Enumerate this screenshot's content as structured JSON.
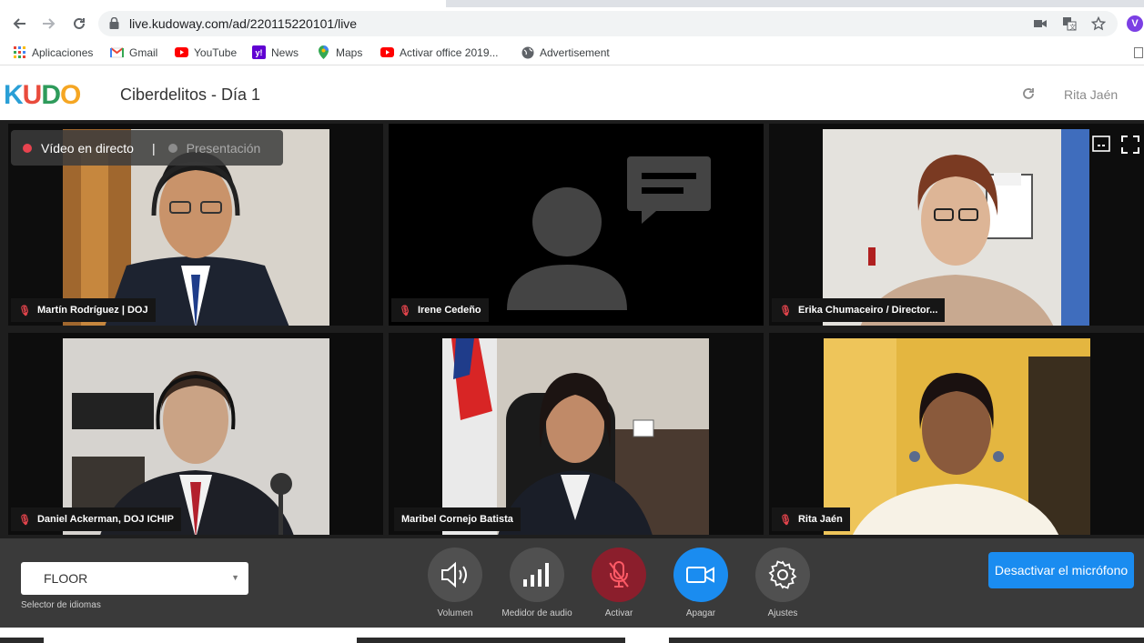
{
  "browser": {
    "url": "live.kudoway.com/ad/220115220101/live",
    "bookmarks": [
      {
        "label": "Aplicaciones",
        "icon": "apps-grid-icon"
      },
      {
        "label": "Gmail",
        "icon": "gmail-icon"
      },
      {
        "label": "YouTube",
        "icon": "youtube-icon"
      },
      {
        "label": "News",
        "icon": "yahoo-icon"
      },
      {
        "label": "Maps",
        "icon": "maps-pin-icon"
      },
      {
        "label": "Activar office 2019...",
        "icon": "youtube-icon"
      },
      {
        "label": "Advertisement",
        "icon": "globe-icon"
      }
    ]
  },
  "app": {
    "logo_letters": [
      "K",
      "U",
      "D",
      "O"
    ],
    "title": "Ciberdelitos - Día 1",
    "user": "Rita Jaén"
  },
  "stream": {
    "live_label": "Vídeo en directo",
    "separator": "|",
    "presentation_label": "Presentación"
  },
  "participants": [
    {
      "name": "Martín Rodríguez | DOJ",
      "muted": true,
      "video": true
    },
    {
      "name": "Irene Cedeño",
      "muted": true,
      "video": false
    },
    {
      "name": "Erika Chumaceiro / Director...",
      "muted": true,
      "video": true
    },
    {
      "name": "Daniel Ackerman, DOJ ICHIP",
      "muted": true,
      "video": true
    },
    {
      "name": "Maribel Cornejo Batista",
      "muted": false,
      "video": true
    },
    {
      "name": "Rita Jaén",
      "muted": true,
      "video": true
    }
  ],
  "controls": {
    "language_value": "FLOOR",
    "language_caption": "Selector de idiomas",
    "volume_label": "Volumen",
    "audio_meter_label": "Medidor de audio",
    "activate_label": "Activar",
    "camera_label": "Apagar",
    "settings_label": "Ajustes",
    "mute_button_label": "Desactivar el micrófono"
  },
  "colors": {
    "accent_blue": "#1a8cf0",
    "mic_off_red": "#e0434b",
    "live_dot": "#e8434f",
    "camera_button": "#1a8cf0",
    "activate_button": "#8b1e2c"
  }
}
